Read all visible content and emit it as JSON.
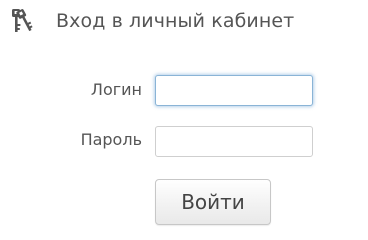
{
  "header": {
    "icon": "keys-icon",
    "title": "Вход в личный кабинет"
  },
  "form": {
    "login": {
      "label": "Логин",
      "value": "",
      "placeholder": ""
    },
    "password": {
      "label": "Пароль",
      "value": "",
      "placeholder": ""
    },
    "submit_label": "Войти"
  },
  "colors": {
    "text": "#555555",
    "focus_border": "#8ab4d6",
    "icon": "#555555"
  }
}
